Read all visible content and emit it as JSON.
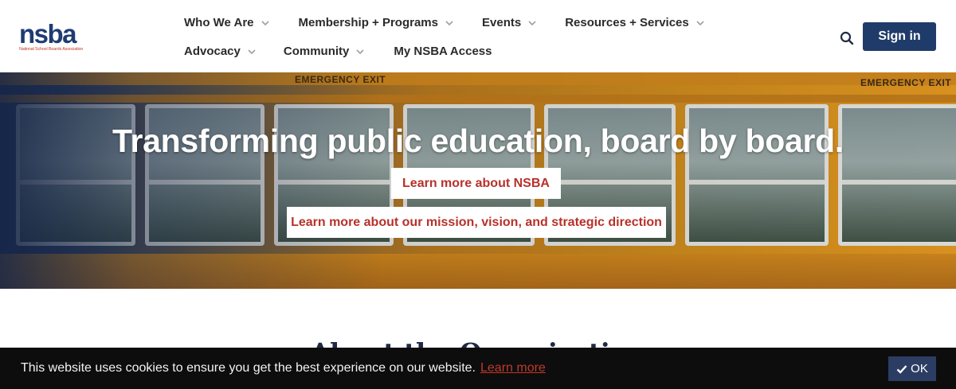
{
  "brand": {
    "logo_text": "nsba",
    "logo_subtext": "National School Boards Association",
    "color": "#1f3b73",
    "accent": "#c0392b"
  },
  "nav": {
    "row1": [
      {
        "label": "Who We Are",
        "has_dropdown": true
      },
      {
        "label": "Membership + Programs",
        "has_dropdown": true
      },
      {
        "label": "Events",
        "has_dropdown": true
      },
      {
        "label": "Resources + Services",
        "has_dropdown": true
      }
    ],
    "row2": [
      {
        "label": "Advocacy",
        "has_dropdown": true
      },
      {
        "label": "Community",
        "has_dropdown": true
      },
      {
        "label": "My NSBA Access",
        "has_dropdown": false
      }
    ],
    "search_icon": "search-icon",
    "sign_in": "Sign in"
  },
  "hero": {
    "exit_left": "EMERGENCY EXIT",
    "exit_right": "EMERGENCY EXIT",
    "title": "Transforming public education, board by board.",
    "button_primary": "Learn more about NSBA",
    "button_secondary": "Learn more about our mission, vision, and strategic direction"
  },
  "section": {
    "title": "About the Organization"
  },
  "cookie": {
    "message": "This website uses cookies to ensure you get the best experience on our website.",
    "link": "Learn more",
    "ok": "OK"
  }
}
